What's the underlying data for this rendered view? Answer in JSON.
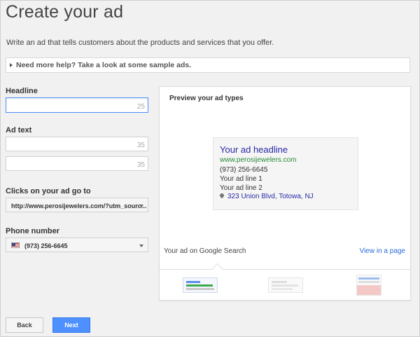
{
  "page": {
    "title": "Create your ad",
    "intro": "Write an ad that tells customers about the products and services that you offer.",
    "help_link": "Need more help? Take a look at some sample ads."
  },
  "form": {
    "headline_label": "Headline",
    "headline_value": "",
    "headline_counter": "25",
    "adtext_label": "Ad text",
    "adtext1_value": "",
    "adtext1_counter": "35",
    "adtext2_value": "",
    "adtext2_counter": "35",
    "clicks_label": "Clicks on your ad go to",
    "clicks_value": "http://www.perosijewelers.com/?utm_sourc...",
    "phone_label": "Phone number",
    "phone_value": "(973) 256-6645"
  },
  "preview": {
    "title": "Preview your ad types",
    "ad_headline": "Your ad headline",
    "ad_url": "www.perosijewelers.com",
    "ad_phone": "(973) 256-6645",
    "ad_line1": "Your ad line 1",
    "ad_line2": "Your ad line 2",
    "ad_address": "323 Union Blvd, Totowa, NJ",
    "ad_type_label": "Your ad on Google Search",
    "view_link": "View in a page"
  },
  "buttons": {
    "back": "Back",
    "next": "Next"
  },
  "colors": {
    "accent": "#4d90fe",
    "headline_link": "#2a2aa8",
    "url_green": "#2a8a3a"
  }
}
